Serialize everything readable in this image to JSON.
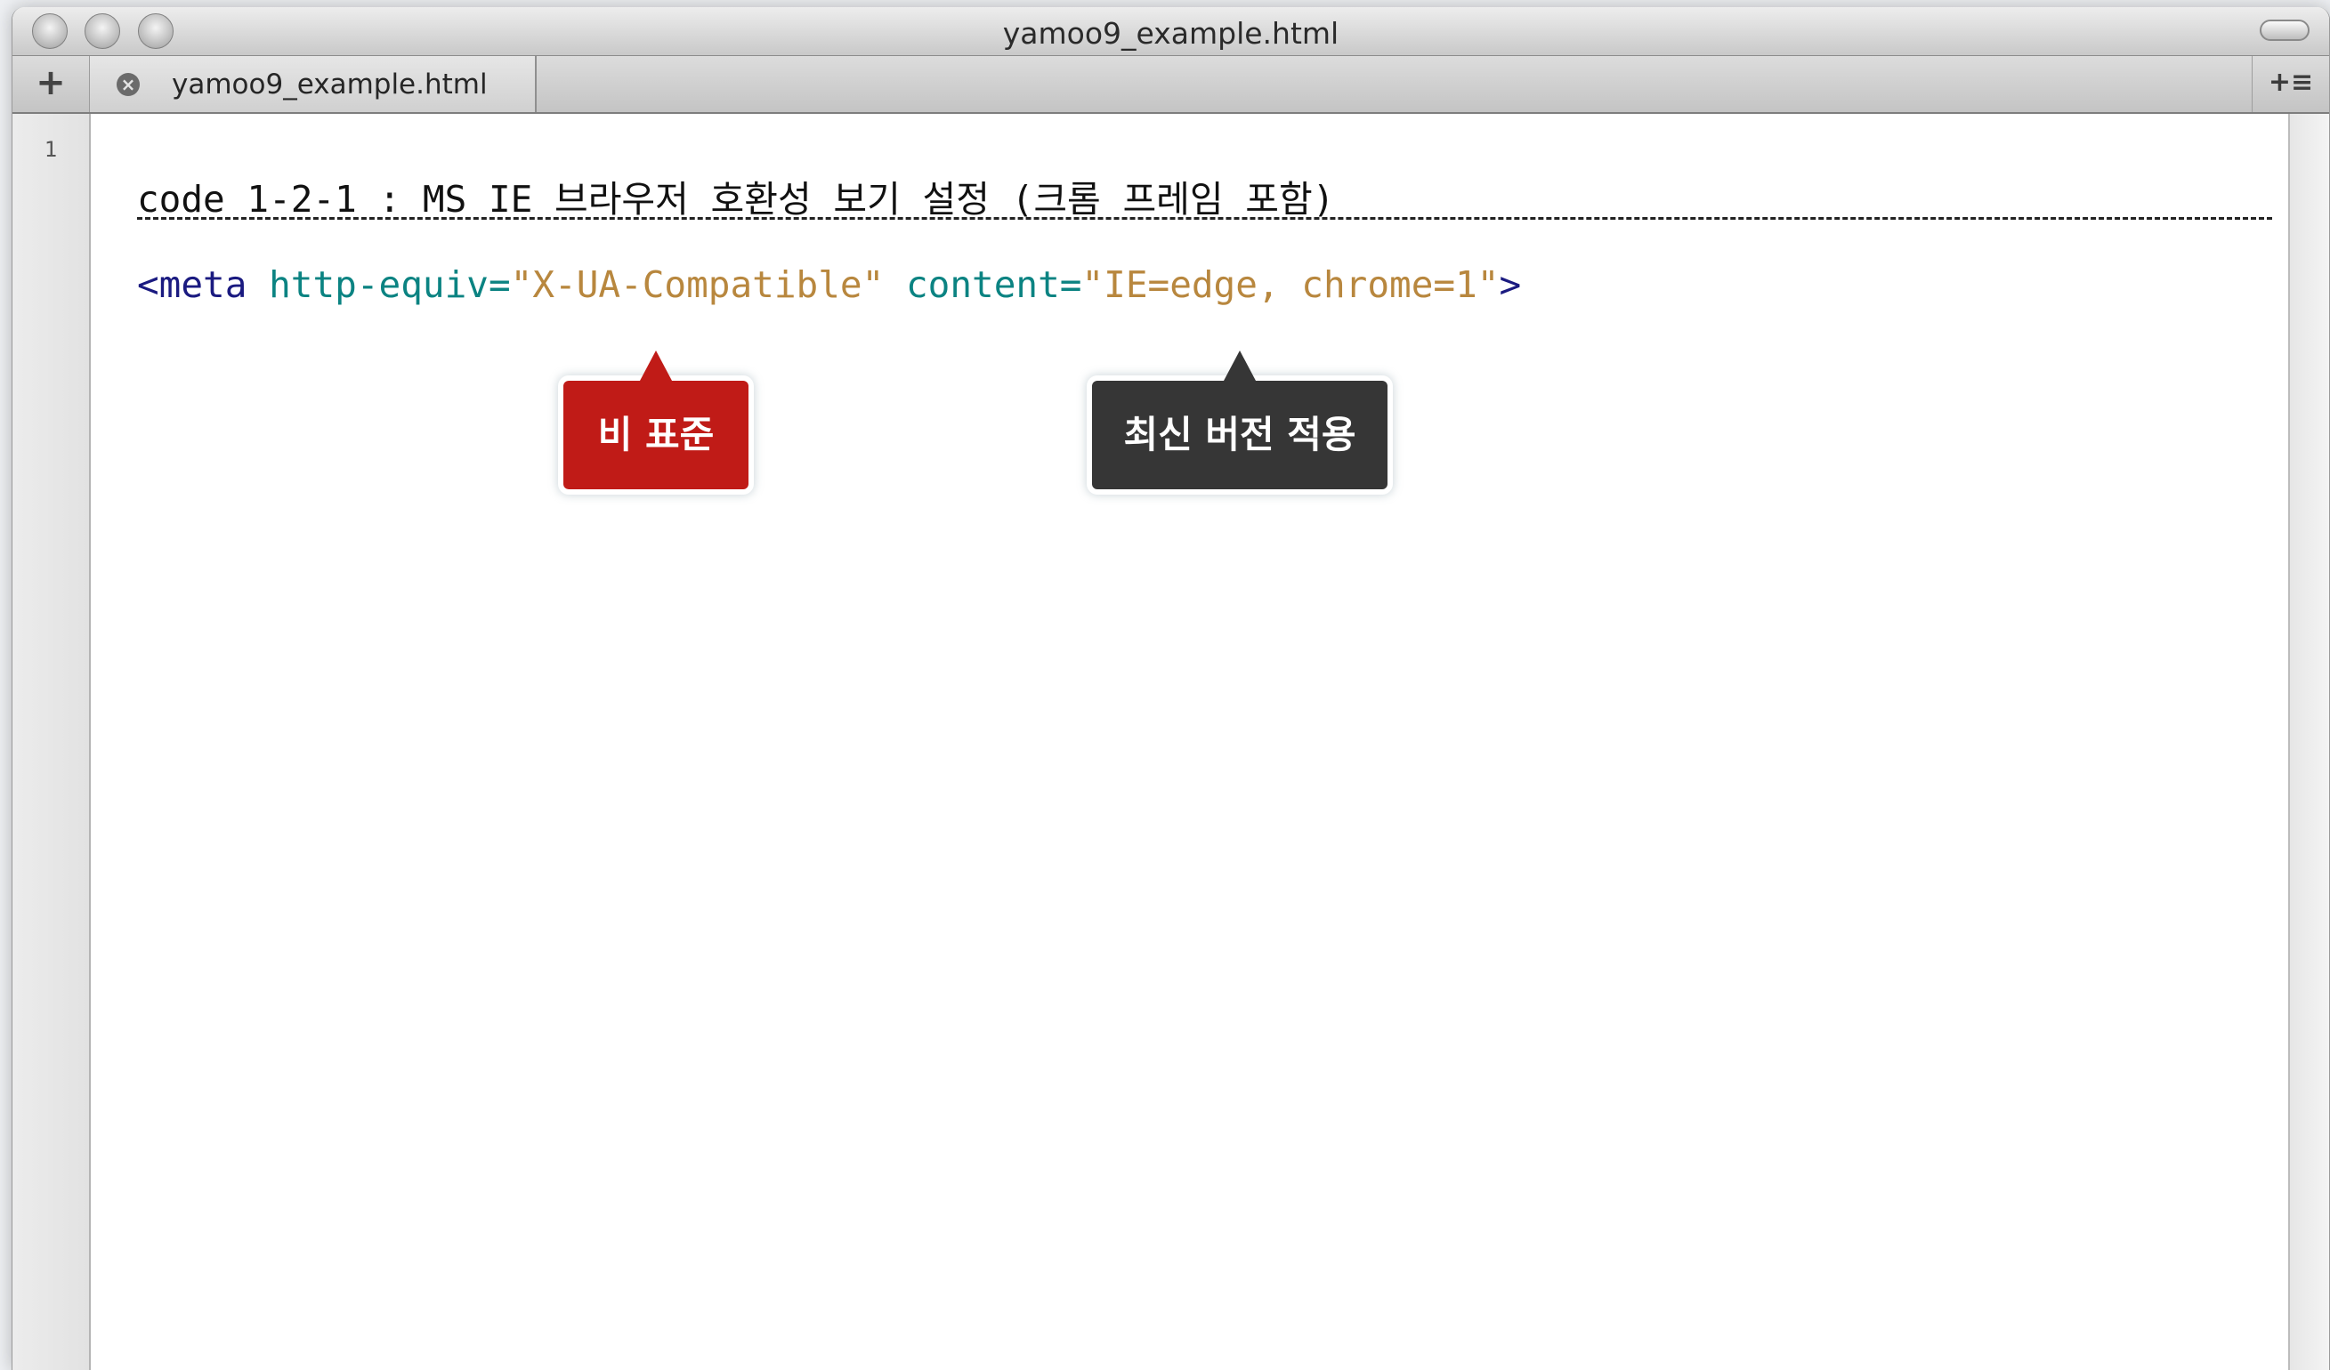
{
  "window": {
    "title": "yamoo9_example.html"
  },
  "tabbar": {
    "add_icon": "+",
    "close_icon": "×",
    "tab_label": "yamoo9_example.html",
    "menu_icon": "+≡"
  },
  "gutter": {
    "line_number": "1"
  },
  "editor": {
    "title_line": "code 1-2-1 : MS IE 브라우저 호환성 보기 설정 (크롬 프레임 포함)",
    "code": {
      "tag_open": "<meta",
      "attr1_name": "http-equiv=",
      "attr1_value": "\"X-UA-Compatible\"",
      "attr2_name": "content=",
      "attr2_value": "\"IE=edge, chrome=1\"",
      "tag_close": ">"
    }
  },
  "callouts": {
    "non_standard": "비 표준",
    "latest_version": "최신 버전 적용"
  },
  "colors": {
    "callout_red": "#c01b17",
    "callout_dark": "#363636",
    "tag": "#1a1a80",
    "attribute": "#0b8382",
    "string": "#b8873e"
  }
}
